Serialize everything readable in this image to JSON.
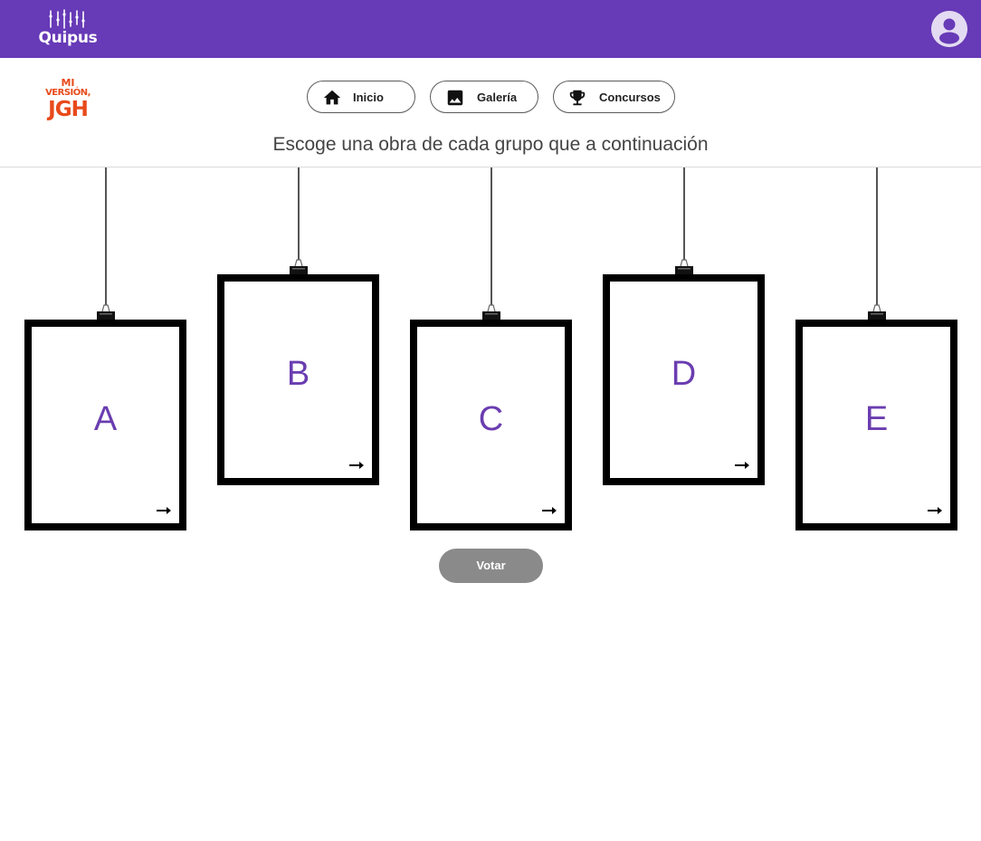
{
  "topbar": {
    "brand_name": "Quipus",
    "account_icon": "account-circle-icon",
    "color": "#673ab7"
  },
  "contest_logo": {
    "line1": "MI",
    "line2": "VERSIÓN,",
    "line3": "JGH",
    "color": "#e84a1b"
  },
  "nav": {
    "inicio": {
      "label": "Inicio",
      "icon": "home-icon"
    },
    "galeria": {
      "label": "Galería",
      "icon": "image-icon"
    },
    "concursos": {
      "label": "Concursos",
      "icon": "trophy-icon"
    }
  },
  "instruction": "Escoge una obra de cada grupo que a continuación",
  "groups": [
    {
      "letter": "A",
      "icon": "arrow-right-icon"
    },
    {
      "letter": "B",
      "icon": "arrow-right-icon"
    },
    {
      "letter": "C",
      "icon": "arrow-right-icon"
    },
    {
      "letter": "D",
      "icon": "arrow-right-icon"
    },
    {
      "letter": "E",
      "icon": "arrow-right-icon"
    }
  ],
  "vote_button": {
    "label": "Votar",
    "color": "#8a8a8a"
  },
  "accent_color": "#6a3db0"
}
